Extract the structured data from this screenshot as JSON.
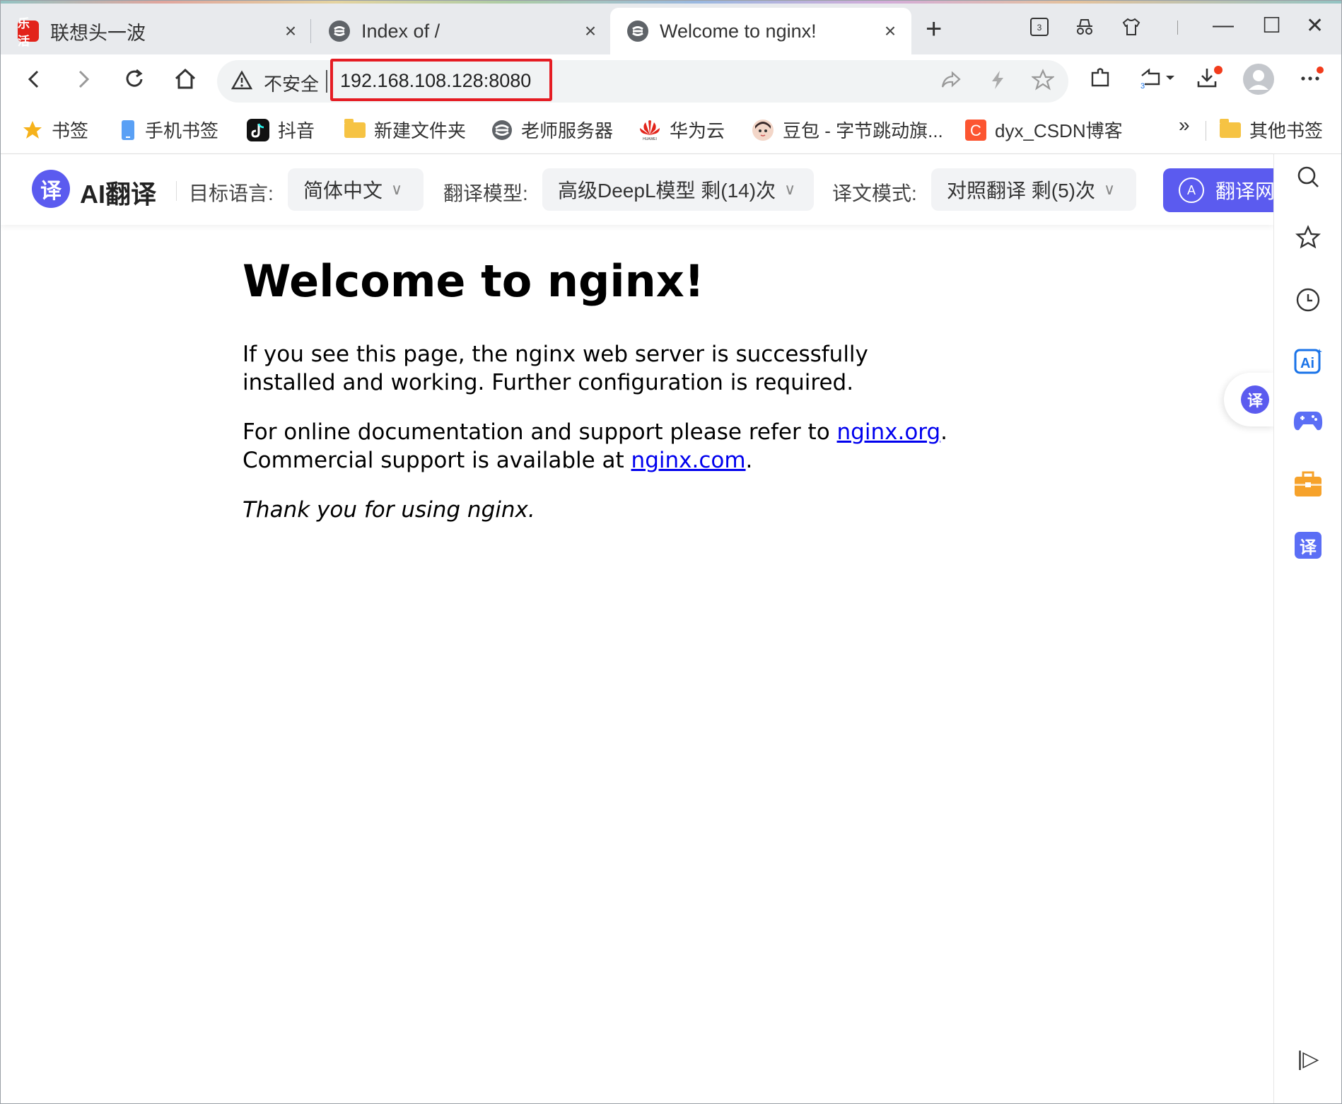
{
  "tabs": [
    {
      "title": "联想头一波",
      "favicon_text": "乐活",
      "close": "×"
    },
    {
      "title": "Index of /",
      "close": "×"
    },
    {
      "title": "Welcome to nginx!",
      "close": "×",
      "active": true
    }
  ],
  "new_tab_label": "+",
  "window_controls": {
    "minimize": "—",
    "maximize": "☐",
    "close": "✕"
  },
  "toolbar": {
    "security_label": "不安全",
    "url": "192.168.108.128:8080",
    "download_badge_color": "#f23c1c"
  },
  "bookmarks": [
    {
      "label": "书签",
      "icon": "star-icon"
    },
    {
      "label": "手机书签",
      "icon": "phone-icon"
    },
    {
      "label": "抖音",
      "icon": "douyin-icon"
    },
    {
      "label": "新建文件夹",
      "icon": "folder-icon"
    },
    {
      "label": "老师服务器",
      "icon": "browser-e-icon"
    },
    {
      "label": "华为云",
      "icon": "huawei-icon"
    },
    {
      "label": "豆包 - 字节跳动旗...",
      "icon": "doubao-icon"
    },
    {
      "label": "dyx_CSDN博客",
      "icon": "csdn-icon"
    }
  ],
  "bookmarks_more": "»",
  "bookmarks_other": "其他书签",
  "translate_bar": {
    "logo_char": "译",
    "title": "AI翻译",
    "target_lang_label": "目标语言:",
    "target_lang_value": "简体中文",
    "model_label": "翻译模型:",
    "model_value": "高级DeepL模型 剩(14)次",
    "mode_label": "译文模式:",
    "mode_value": "对照翻译 剩(5)次",
    "translate_button": "翻译网",
    "accent_color": "#5b5bef"
  },
  "page": {
    "heading": "Welcome to nginx!",
    "para1": "If you see this page, the nginx web server is successfully installed and working. Further configuration is required.",
    "para2_prefix": "For online documentation and support please refer to ",
    "link_org": "nginx.org",
    "para2_mid": ".",
    "para2_line2": "Commercial support is available at ",
    "link_com": "nginx.com",
    "para2_end": ".",
    "para3": "Thank you for using nginx."
  },
  "sidepanel": {
    "float_char": "译",
    "ai_label": "Ai",
    "translate_char": "译",
    "collapse": "|▷"
  }
}
